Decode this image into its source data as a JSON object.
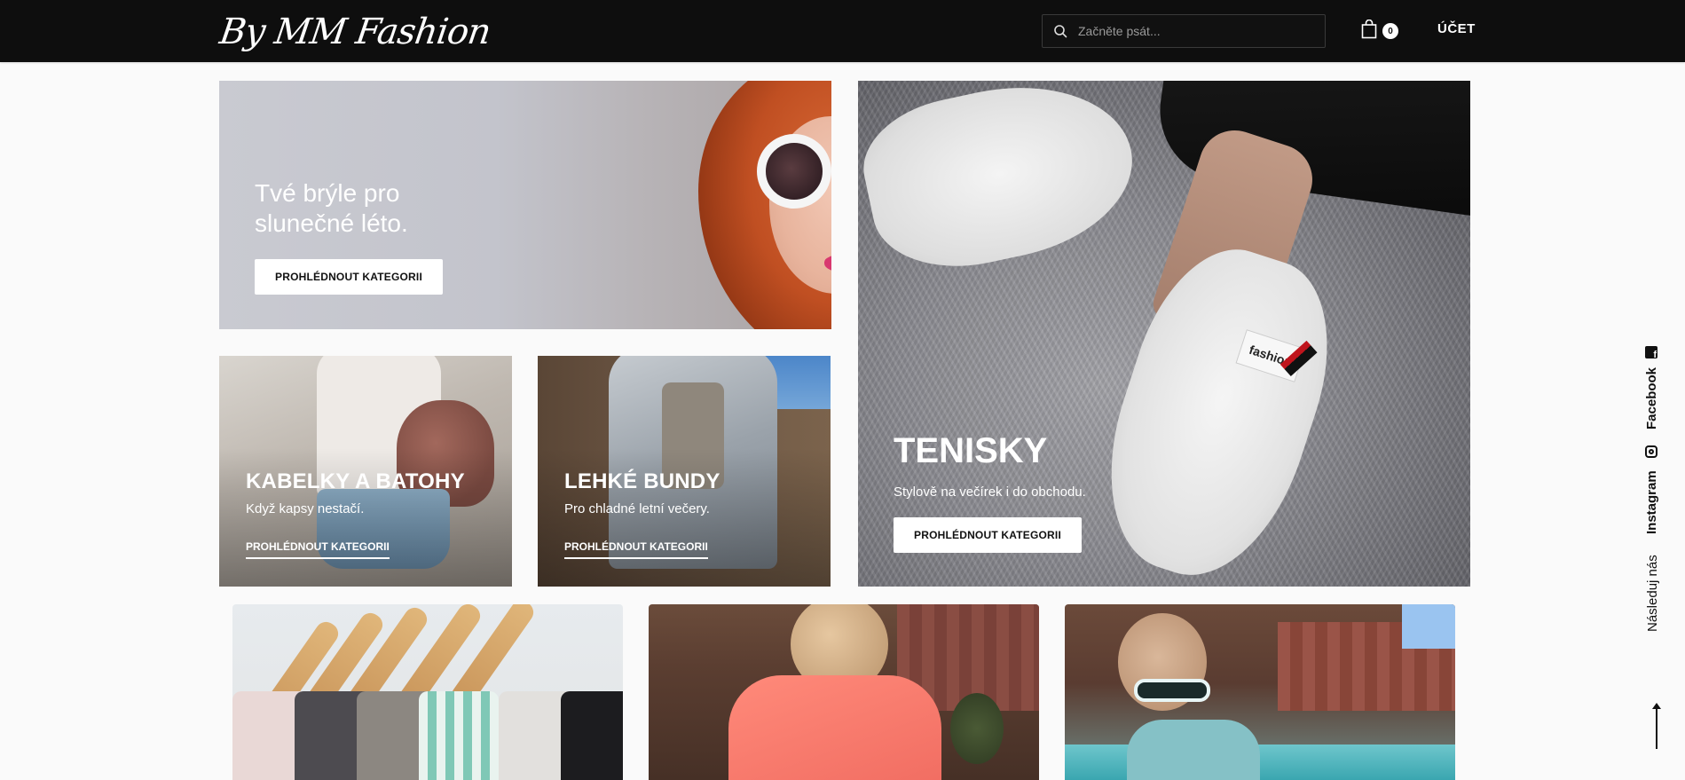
{
  "header": {
    "logo_text": "By MM Fashion",
    "search_placeholder": "Začněte psát...",
    "cart_count": "0",
    "account_label": "ÚČET",
    "icons": {
      "search": "search-icon",
      "cart": "shopping-bag-icon"
    }
  },
  "hero": {
    "sunglasses": {
      "text": "Tvé brýle pro slunečné léto.",
      "button": "PROHLÉDNOUT KATEGORII"
    },
    "bags": {
      "title": "KABELKY A BATOHY",
      "subtitle": "Když kapsy nestačí.",
      "link": "PROHLÉDNOUT KATEGORII"
    },
    "jackets": {
      "title": "LEHKÉ BUNDY",
      "subtitle": "Pro chladné letní večery.",
      "link": "PROHLÉDNOUT KATEGORII"
    },
    "sneakers": {
      "title": "TENISKY",
      "subtitle": "Stylově na večírek i do obchodu.",
      "button": "PROHLÉDNOUT KATEGORII",
      "shoe_label": "fashion"
    }
  },
  "social": {
    "facebook": "Facebook",
    "instagram": "Instagram",
    "follow": "Následuj nás",
    "icons": {
      "facebook": "facebook-icon",
      "instagram": "instagram-icon",
      "scroll_top": "arrow-up-icon"
    }
  },
  "colors": {
    "header_bg": "#0e0e0e",
    "page_bg": "#fafafa",
    "button_bg": "#ffffff",
    "text_dark": "#111111"
  }
}
